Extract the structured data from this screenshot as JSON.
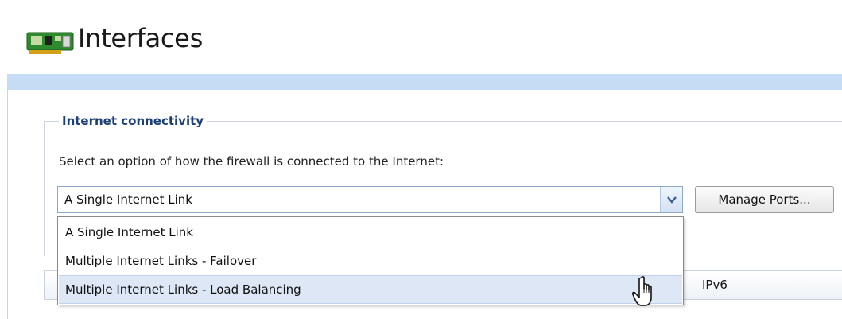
{
  "header": {
    "title": "Interfaces",
    "icon": "network-card-icon"
  },
  "connectivity_group": {
    "legend": "Internet connectivity",
    "instruction": "Select an option of how the firewall is connected to the Internet:",
    "select": {
      "value": "A Single Internet Link",
      "icon": "chevron-down-icon",
      "options": [
        "A Single Internet Link",
        "Multiple Internet Links - Failover",
        "Multiple Internet Links - Load Balancing"
      ],
      "highlighted_option_index": 2
    },
    "manage_ports_label": "Manage Ports..."
  },
  "table": {
    "visible_column": "IPv6"
  },
  "colors": {
    "header_band": "#c6dcf5",
    "legend_text": "#1c3f77",
    "highlight": "#dde7f5",
    "select_border": "#8ea8c9"
  }
}
